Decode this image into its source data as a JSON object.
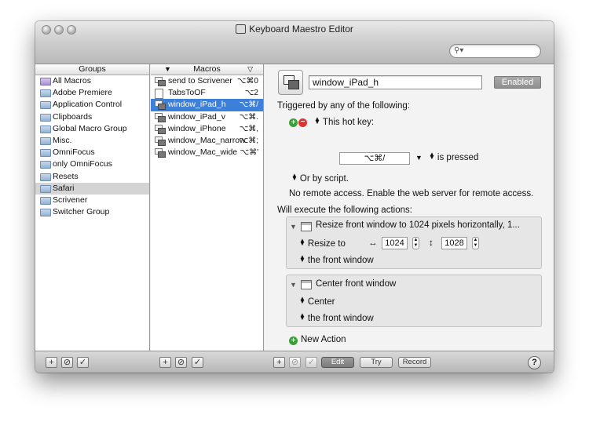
{
  "window": {
    "title": "Keyboard Maestro Editor"
  },
  "search": {
    "placeholder": ""
  },
  "groups": {
    "header": "Groups",
    "items": [
      {
        "label": "All Macros",
        "selected": false
      },
      {
        "label": "Adobe Premiere",
        "selected": false
      },
      {
        "label": "Application Control",
        "selected": false
      },
      {
        "label": "Clipboards",
        "selected": false
      },
      {
        "label": "Global Macro Group",
        "selected": false
      },
      {
        "label": "Misc.",
        "selected": false
      },
      {
        "label": "OmniFocus",
        "selected": false
      },
      {
        "label": "only OmniFocus",
        "selected": false
      },
      {
        "label": "Resets",
        "selected": false
      },
      {
        "label": "Safari",
        "selected": true
      },
      {
        "label": "Scrivener",
        "selected": false
      },
      {
        "label": "Switcher Group",
        "selected": false
      }
    ]
  },
  "macros": {
    "header": "Macros",
    "items": [
      {
        "label": "send to Scrivener",
        "hotkey": "⌥⌘0",
        "selected": false
      },
      {
        "label": "TabsToOF",
        "hotkey": "⌥2",
        "selected": false
      },
      {
        "label": "window_iPad_h",
        "hotkey": "⌥⌘/",
        "selected": true
      },
      {
        "label": "window_iPad_v",
        "hotkey": "⌥⌘.",
        "selected": false
      },
      {
        "label": "window_iPhone",
        "hotkey": "⌥⌘,",
        "selected": false
      },
      {
        "label": "window_Mac_narrow",
        "hotkey": "⌥⌘;",
        "selected": false
      },
      {
        "label": "window_Mac_wide",
        "hotkey": "⌥⌘'",
        "selected": false
      }
    ]
  },
  "editor": {
    "macro_name": "window_iPad_h",
    "enabled_label": "Enabled",
    "triggered_label": "Triggered by any of the following:",
    "trigger_type": "This hot key:",
    "hotkey": "⌥⌘/",
    "pressed_label": "is pressed",
    "or_script": "Or by script.",
    "remote_access": "No remote access.  Enable the web server for remote access.",
    "will_execute": "Will execute the following actions:",
    "actions": [
      {
        "title": "Resize front window to 1024 pixels horizontally, 1...",
        "resize_label": "Resize to",
        "width_symbol": "↔",
        "width": "1024",
        "height_symbol": "↕",
        "height": "1028",
        "target": "the front window"
      },
      {
        "title": "Center front window",
        "center_label": "Center",
        "target": "the front window"
      }
    ],
    "new_action": "New Action"
  },
  "toolbar": {
    "edit": "Edit",
    "try": "Try",
    "record": "Record",
    "help": "?"
  }
}
